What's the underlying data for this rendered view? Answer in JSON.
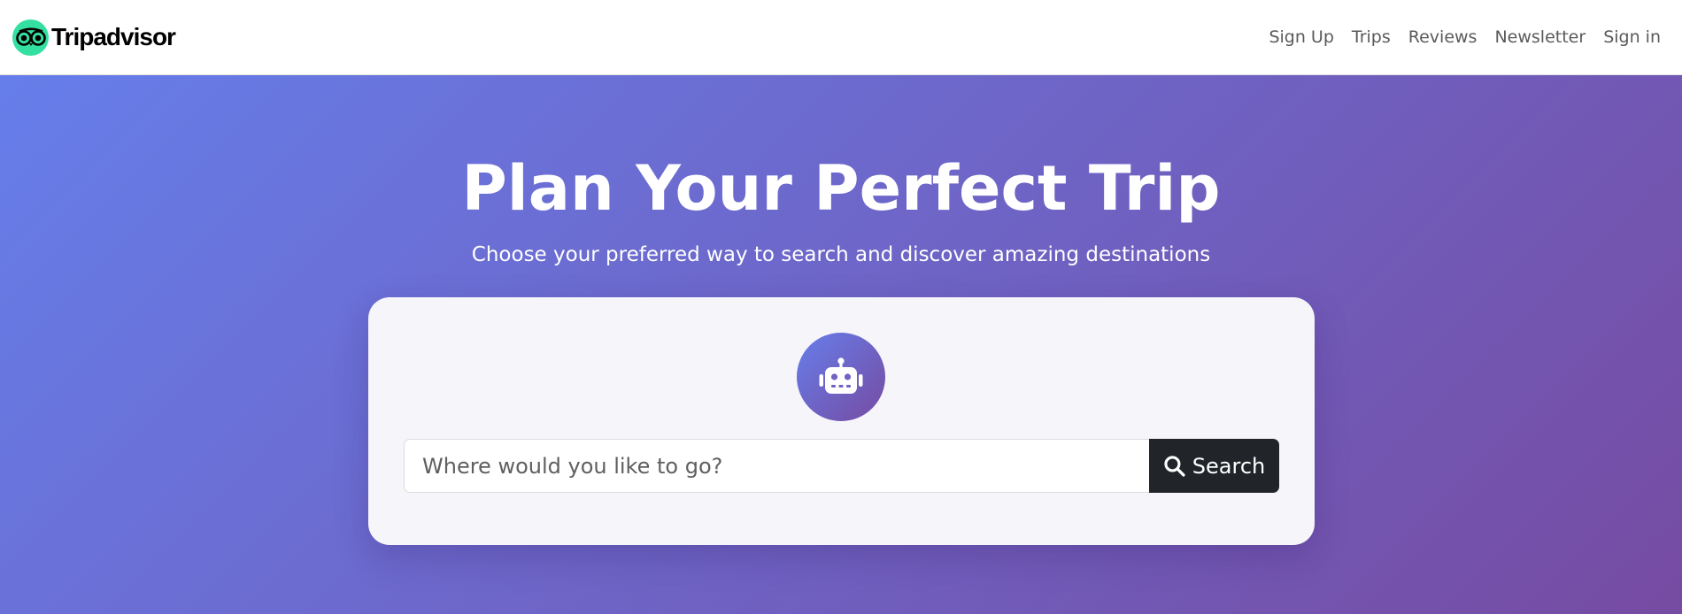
{
  "header": {
    "brand_name": "Tripadvisor",
    "brand_icon": "owl-eyes-icon",
    "nav_links": [
      {
        "label": "Sign Up"
      },
      {
        "label": "Trips"
      },
      {
        "label": "Reviews"
      },
      {
        "label": "Newsletter"
      },
      {
        "label": "Sign in"
      }
    ]
  },
  "hero": {
    "title": "Plan Your Perfect Trip",
    "subtitle": "Choose your preferred way to search and discover amazing destinations",
    "gradient_colors": [
      "#667eea",
      "#764ba2"
    ]
  },
  "search_card": {
    "icon": "robot-icon",
    "search": {
      "placeholder": "Where would you like to go?",
      "value": ""
    },
    "search_button": {
      "label": "Search",
      "icon": "search-icon"
    }
  },
  "colors": {
    "brand_green": "#34e0a1",
    "button_dark": "#212529",
    "card_background": "#f6f5fa"
  }
}
